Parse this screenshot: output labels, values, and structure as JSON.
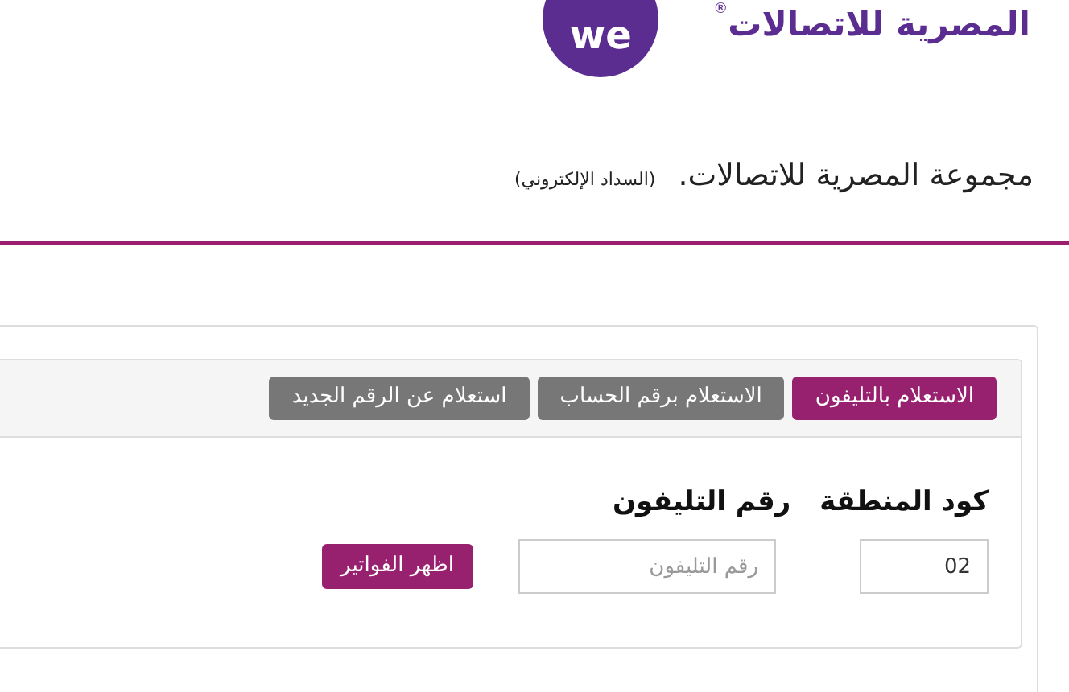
{
  "header": {
    "logo_mark": "we",
    "logo_text": "المصرية للاتصالات",
    "logo_registered": "®"
  },
  "title": {
    "text": "مجموعة المصرية للاتصالات.",
    "subtitle": "(السداد الإلكتروني)"
  },
  "tabs": [
    {
      "label": "الاستعلام بالتليفون",
      "selected": true
    },
    {
      "label": "الاستعلام برقم الحساب",
      "selected": false
    },
    {
      "label": "استعلام عن الرقم الجديد",
      "selected": false
    }
  ],
  "form": {
    "area_code_label": "كود المنطقة",
    "phone_label": "رقم التليفون",
    "area_code_value": "02",
    "phone_placeholder": "رقم التليفون",
    "submit": "اظهر الفواتير"
  }
}
